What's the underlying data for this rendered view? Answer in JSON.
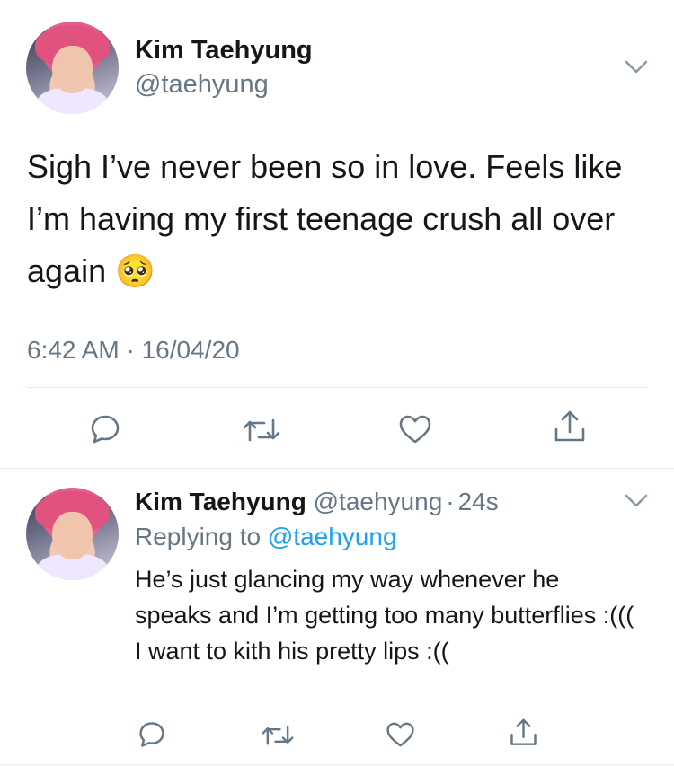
{
  "main_tweet": {
    "author_name": "Kim Taehyung",
    "author_handle": "@taehyung",
    "text": "Sigh I’ve never been so in love. Feels like I’m having my first teenage crush all over again",
    "emoji": "🥺",
    "timestamp": "6:42 AM · 16/04/20",
    "actions": [
      "reply-icon",
      "retweet-icon",
      "like-icon",
      "share-icon"
    ]
  },
  "reply_tweet": {
    "author_name": "Kim Taehyung",
    "author_handle": "@taehyung",
    "separator": "·",
    "age": "24s",
    "replying_prefix": "Replying to",
    "replying_to": "@taehyung",
    "text": "He’s just glancing my way whenever he speaks and I’m getting too many butterflies :((( I want to kith his pretty lips :((",
    "actions": [
      "reply-icon",
      "retweet-icon",
      "like-icon",
      "share-icon"
    ]
  },
  "colors": {
    "text": "#14171a",
    "secondary": "#657786",
    "link": "#1da1f2",
    "divider": "#e1e8ed"
  }
}
